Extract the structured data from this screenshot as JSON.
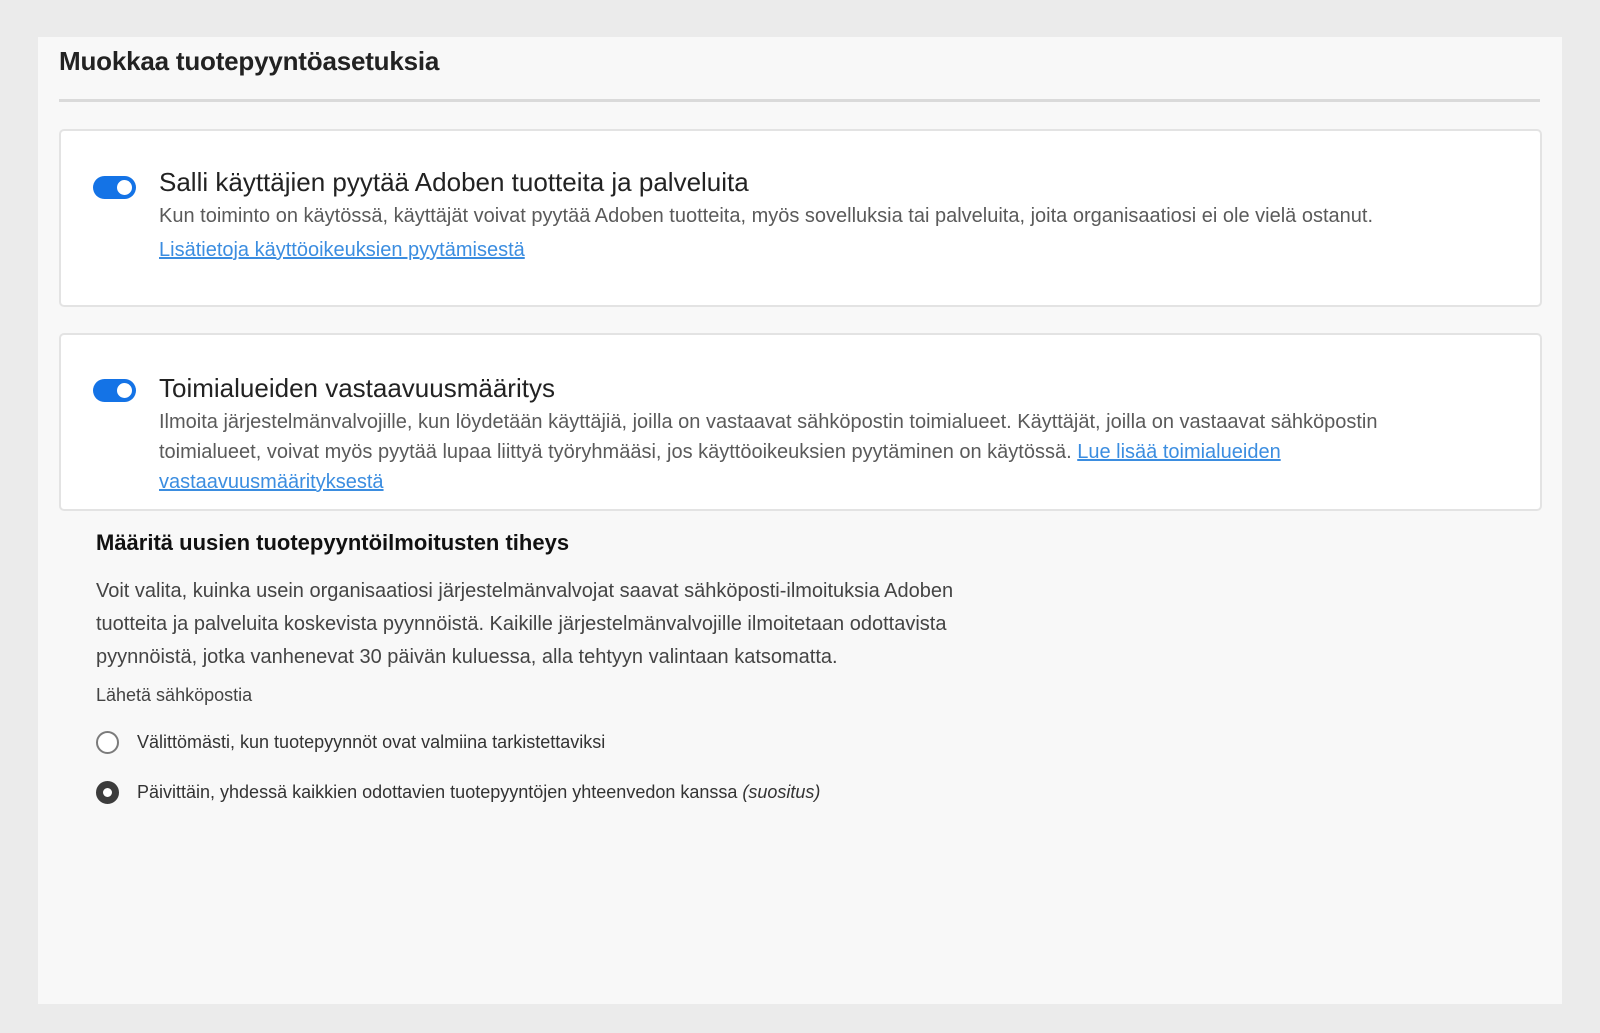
{
  "page": {
    "title": "Muokkaa tuotepyyntöasetuksia"
  },
  "cards": [
    {
      "toggle_on": true,
      "title": "Salli käyttäjien pyytää Adoben tuotteita ja palveluita",
      "description": "Kun toiminto on käytössä, käyttäjät voivat pyytää Adoben tuotteita, myös sovelluksia tai palveluita, joita organisaatiosi ei ole vielä ostanut.",
      "link": "Lisätietoja käyttöoikeuksien pyytämisestä"
    },
    {
      "toggle_on": true,
      "title": "Toimialueiden vastaavuusmääritys",
      "description": "Ilmoita järjestelmänvalvojille, kun löydetään käyttäjiä, joilla on vastaavat sähköpostin toimialueet. Käyttäjät, joilla on vastaavat sähköpostin toimialueet, voivat myös pyytää lupaa liittyä työryhmääsi, jos käyttöoikeuksien pyytäminen on käytössä.",
      "link": "Lue lisää toimialueiden vastaavuusmäärityksestä"
    }
  ],
  "frequency": {
    "title": "Määritä uusien tuotepyyntöilmoitusten tiheys",
    "description": "Voit valita, kuinka usein organisaatiosi järjestelmänvalvojat saavat sähköposti-ilmoituksia Adoben tuotteita ja palveluita koskevista pyynnöistä. Kaikille järjestelmänvalvojille ilmoitetaan odottavista pyynnöistä, jotka vanhenevat 30 päivän kuluessa, alla tehtyyn valintaan katsomatta.",
    "email_label": "Lähetä sähköpostia",
    "options": [
      {
        "label": "Välittömästi, kun tuotepyynnöt ovat valmiina tarkistettaviksi",
        "suffix": "",
        "selected": false
      },
      {
        "label": "Päivittäin, yhdessä kaikkien odottavien tuotepyyntöjen yhteenvedon kanssa",
        "suffix": "(suositus)",
        "selected": true
      }
    ]
  },
  "colors": {
    "toggle_on": "#1473e6",
    "link": "#3b8de0",
    "background": "#ebebeb",
    "panel": "#f8f8f8"
  }
}
